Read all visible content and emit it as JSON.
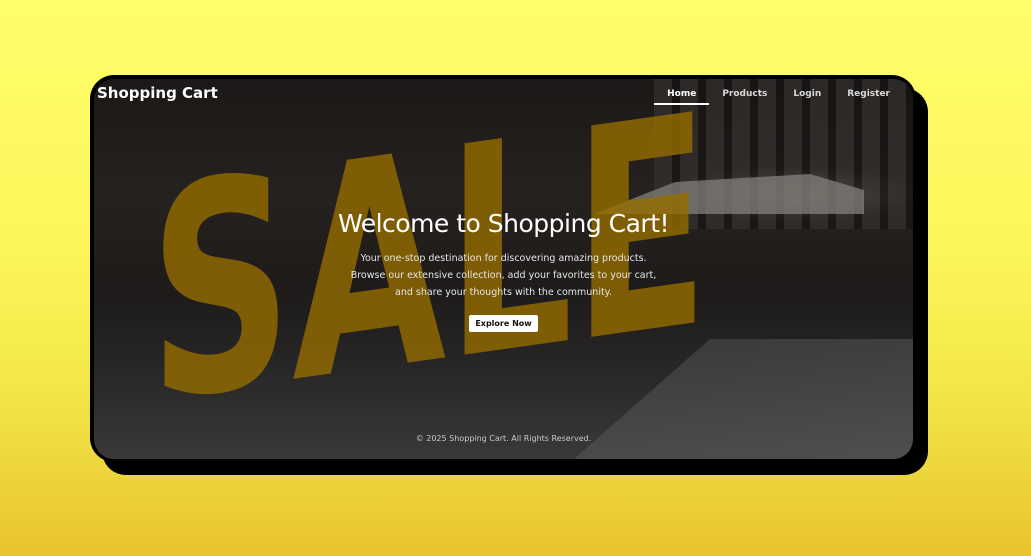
{
  "brand": "Shopping Cart",
  "nav": [
    {
      "label": "Home",
      "active": true
    },
    {
      "label": "Products"
    },
    {
      "label": "Login"
    },
    {
      "label": "Register"
    }
  ],
  "hero": {
    "title": "Welcome to Shopping Cart!",
    "subtitle": "Your one-stop destination for discovering amazing products. Browse our extensive collection, add your favorites to your cart, and share your thoughts with the community.",
    "cta": "Explore Now"
  },
  "background_sign": "SALE",
  "footer": "© 2025 Shopping Cart. All Rights Reserved.",
  "colors": {
    "accent": "#e6a800",
    "page_bg": "#fdf85e"
  }
}
